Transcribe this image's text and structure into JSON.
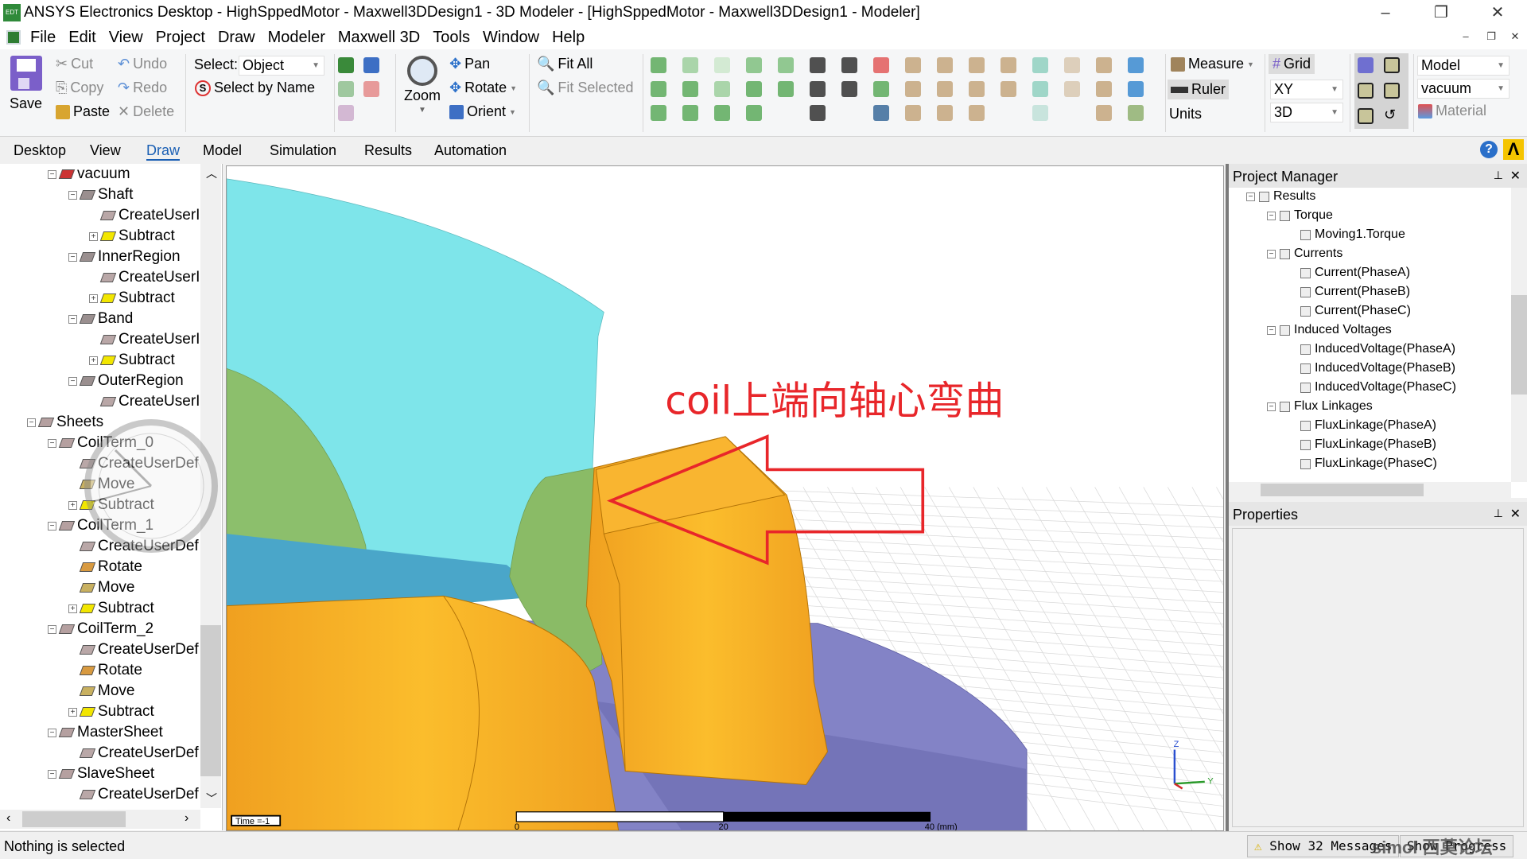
{
  "titlebar": {
    "title": "ANSYS Electronics Desktop - HighSppedMotor - Maxwell3DDesign1 - 3D Modeler - [HighSppedMotor - Maxwell3DDesign1 - Modeler]",
    "app_icon": "aedt-icon",
    "minimize": "–",
    "restore": "❐",
    "close": "✕"
  },
  "menu": {
    "items": [
      "File",
      "Edit",
      "View",
      "Project",
      "Draw",
      "Modeler",
      "Maxwell 3D",
      "Tools",
      "Window",
      "Help"
    ]
  },
  "ribbon": {
    "save": "Save",
    "cut": "Cut",
    "copy": "Copy",
    "paste": "Paste",
    "undo": "Undo",
    "redo": "Redo",
    "delete": "Delete",
    "select_label": "Select:",
    "select_value": "Object",
    "select_by_name": "Select by Name",
    "zoom": "Zoom",
    "pan": "Pan",
    "rotate": "Rotate",
    "orient": "Orient",
    "fit_all": "Fit All",
    "fit_selected": "Fit Selected",
    "measure": "Measure",
    "ruler": "Ruler",
    "units": "Units",
    "grid": "Grid",
    "plane_value": "XY",
    "mode_value": "3D",
    "model_value": "Model",
    "material_value": "vacuum",
    "material": "Material"
  },
  "tabs": {
    "items": [
      "Desktop",
      "View",
      "Draw",
      "Model",
      "Simulation",
      "Results",
      "Automation"
    ],
    "active": "Draw",
    "active_color": "#1a5fb4"
  },
  "model_tree": [
    {
      "label": "vacuum",
      "level": 1,
      "icon": "material-icon",
      "toggle": "−"
    },
    {
      "label": "Shaft",
      "level": 2,
      "icon": "solid-icon",
      "toggle": "−"
    },
    {
      "label": "CreateUserI",
      "level": 3,
      "icon": "create-icon"
    },
    {
      "label": "Subtract",
      "level": 3,
      "icon": "subtract-icon",
      "toggle": "+"
    },
    {
      "label": "InnerRegion",
      "level": 2,
      "icon": "solid-icon",
      "toggle": "−"
    },
    {
      "label": "CreateUserI",
      "level": 3,
      "icon": "create-icon"
    },
    {
      "label": "Subtract",
      "level": 3,
      "icon": "subtract-icon",
      "toggle": "+"
    },
    {
      "label": "Band",
      "level": 2,
      "icon": "solid-icon",
      "toggle": "−"
    },
    {
      "label": "CreateUserI",
      "level": 3,
      "icon": "create-icon"
    },
    {
      "label": "Subtract",
      "level": 3,
      "icon": "subtract-icon",
      "toggle": "+"
    },
    {
      "label": "OuterRegion",
      "level": 2,
      "icon": "solid-icon",
      "toggle": "−"
    },
    {
      "label": "CreateUserI",
      "level": 3,
      "icon": "create-icon"
    },
    {
      "label": "Sheets",
      "level": 0,
      "icon": "sheet-icon",
      "toggle": "−"
    },
    {
      "label": "CoilTerm_0",
      "level": 1,
      "icon": "sheet-icon",
      "toggle": "−"
    },
    {
      "label": "CreateUserDef",
      "level": 2,
      "icon": "create-icon"
    },
    {
      "label": "Move",
      "level": 2,
      "icon": "move-icon"
    },
    {
      "label": "Subtract",
      "level": 2,
      "icon": "subtract-icon",
      "toggle": "+"
    },
    {
      "label": "CoilTerm_1",
      "level": 1,
      "icon": "sheet-icon",
      "toggle": "−"
    },
    {
      "label": "CreateUserDef",
      "level": 2,
      "icon": "create-icon"
    },
    {
      "label": "Rotate",
      "level": 2,
      "icon": "rotate-icon"
    },
    {
      "label": "Move",
      "level": 2,
      "icon": "move-icon"
    },
    {
      "label": "Subtract",
      "level": 2,
      "icon": "subtract-icon",
      "toggle": "+"
    },
    {
      "label": "CoilTerm_2",
      "level": 1,
      "icon": "sheet-icon",
      "toggle": "−"
    },
    {
      "label": "CreateUserDef",
      "level": 2,
      "icon": "create-icon"
    },
    {
      "label": "Rotate",
      "level": 2,
      "icon": "rotate-icon"
    },
    {
      "label": "Move",
      "level": 2,
      "icon": "move-icon"
    },
    {
      "label": "Subtract",
      "level": 2,
      "icon": "subtract-icon",
      "toggle": "+"
    },
    {
      "label": "MasterSheet",
      "level": 1,
      "icon": "sheet-icon",
      "toggle": "−"
    },
    {
      "label": "CreateUserDef",
      "level": 2,
      "icon": "create-icon"
    },
    {
      "label": "SlaveSheet",
      "level": 1,
      "icon": "sheet-icon",
      "toggle": "−"
    },
    {
      "label": "CreateUserDef",
      "level": 2,
      "icon": "create-icon"
    }
  ],
  "viewport": {
    "annotation": "coil上端向轴心弯曲",
    "annotation_color": "#e8262a",
    "time_label": "Time =-1",
    "ruler_labels": [
      "0",
      "20",
      "40 (mm)"
    ],
    "axis_labels": {
      "z": "Z",
      "y": "Y"
    },
    "colors": {
      "cyan": "#7ee5ea",
      "green": "#8cbf6c",
      "orange": "#f6a81e",
      "purple": "#8383c6",
      "blue": "#4aa6c9"
    }
  },
  "project_manager": {
    "title": "Project Manager",
    "items": [
      {
        "label": "Results",
        "level": 0,
        "toggle": "−"
      },
      {
        "label": "Torque",
        "level": 1,
        "toggle": "−"
      },
      {
        "label": "Moving1.Torque",
        "level": 2
      },
      {
        "label": "Currents",
        "level": 1,
        "toggle": "−"
      },
      {
        "label": "Current(PhaseA)",
        "level": 2
      },
      {
        "label": "Current(PhaseB)",
        "level": 2
      },
      {
        "label": "Current(PhaseC)",
        "level": 2
      },
      {
        "label": "Induced Voltages",
        "level": 1,
        "toggle": "−"
      },
      {
        "label": "InducedVoltage(PhaseA)",
        "level": 2
      },
      {
        "label": "InducedVoltage(PhaseB)",
        "level": 2
      },
      {
        "label": "InducedVoltage(PhaseC)",
        "level": 2
      },
      {
        "label": "Flux Linkages",
        "level": 1,
        "toggle": "−"
      },
      {
        "label": "FluxLinkage(PhaseA)",
        "level": 2
      },
      {
        "label": "FluxLinkage(PhaseB)",
        "level": 2
      },
      {
        "label": "FluxLinkage(PhaseC)",
        "level": 2
      }
    ]
  },
  "properties": {
    "title": "Properties"
  },
  "status": {
    "text": "Nothing is selected",
    "messages": "Show 32 Messages",
    "progress": "Show Progress",
    "watermark": "simol 西莫论坛"
  }
}
